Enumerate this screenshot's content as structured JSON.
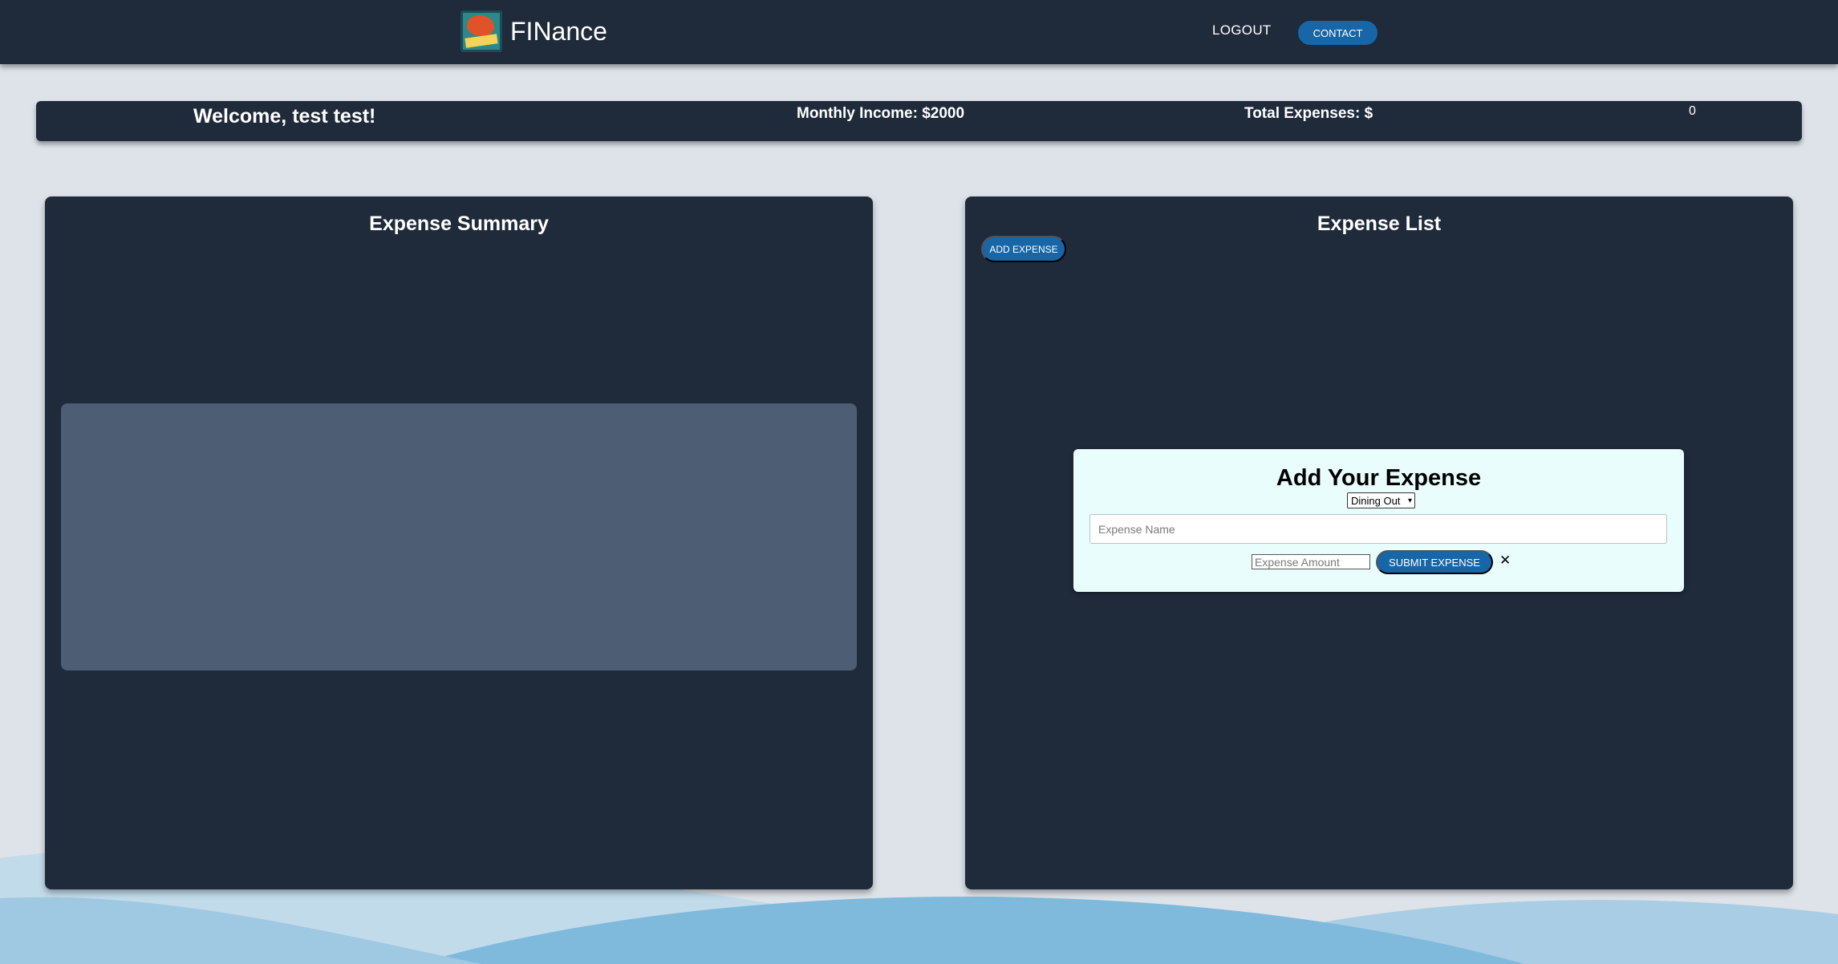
{
  "header": {
    "brand_name": "FINance",
    "logo_text": "FINANCE",
    "logout_label": "LOGOUT",
    "contact_label": "CONTACT"
  },
  "stats": {
    "welcome": "Welcome, test test!",
    "monthly_income": "Monthly Income: $2000",
    "total_expenses_label": "Total Expenses: $",
    "total_expenses_value": "0"
  },
  "summary_panel": {
    "title": "Expense Summary"
  },
  "list_panel": {
    "title": "Expense List",
    "add_button_label": "ADD EXPENSE"
  },
  "modal": {
    "title": "Add Your Expense",
    "category_selected": "Dining Out",
    "name_placeholder": "Expense Name",
    "amount_placeholder": "Expense Amount",
    "submit_label": "SUBMIT EXPENSE",
    "close_glyph": "✕"
  },
  "colors": {
    "nav_bg": "#1f2a3a",
    "page_bg": "#dde3e8",
    "accent": "#1766a8",
    "modal_bg": "#e9fdfd",
    "wave": "#7fbadd"
  }
}
